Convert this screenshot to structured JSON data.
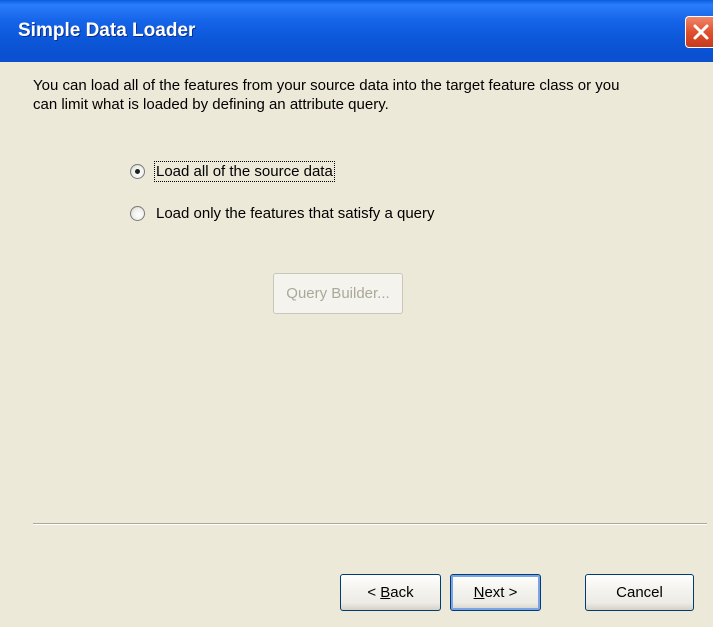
{
  "window": {
    "title": "Simple Data Loader"
  },
  "description": "You can load all of the features from your source data into the target feature class or you can limit what is loaded by defining an attribute query.",
  "options": [
    {
      "label": "Load all of the source data",
      "selected": true
    },
    {
      "label": "Load only the features that satisfy a query",
      "selected": false
    }
  ],
  "query_builder": {
    "label": "Query Builder...",
    "enabled": false
  },
  "buttons": {
    "back": {
      "prefix": "< ",
      "mnemonic": "B",
      "rest": "ack"
    },
    "next": {
      "prefix": "",
      "mnemonic": "N",
      "rest": "ext >"
    },
    "cancel": "Cancel"
  }
}
